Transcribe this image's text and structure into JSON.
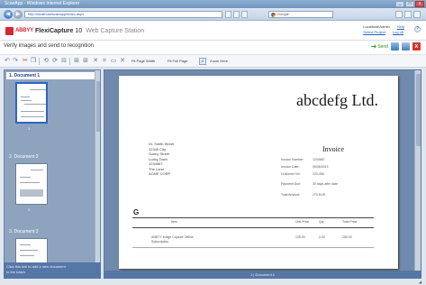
{
  "window": {
    "title": "ScanApp - Windows Internet Explorer",
    "buttons": {
      "minimize": "_",
      "maximize": "□",
      "close": "x"
    }
  },
  "browser": {
    "url": "http://localhost/scanapp/index.aspx",
    "search_placeholder": "Google",
    "back": "◀",
    "forward": "▶"
  },
  "app": {
    "brand": "ABBYY",
    "product": "FlexiCapture",
    "version": "10",
    "subtitle": "Web Capture Station",
    "header_links": {
      "line1": "Localhost\\Admin",
      "line2": "Select Project",
      "help": "Help",
      "logout": "Log off"
    },
    "help_icon": "?"
  },
  "instruction": {
    "text": "Verify images and send to recognition",
    "next_label": "Send",
    "close_glyph": "x"
  },
  "toolbar": {
    "icons": [
      "undo-icon",
      "redo-icon",
      "cut-icon",
      "copy-icon",
      "rotate-left-icon",
      "rotate-right-icon",
      "split-icon",
      "merge-icon",
      "delete-icon",
      "crop-icon",
      "deskew-icon",
      "zoom-icon"
    ],
    "glyphs": {
      "undo": "↶",
      "redo": "↷",
      "cut": "✂",
      "copy": "❐",
      "rotate_left": "⟲",
      "rotate_right": "⟳",
      "split": "⊟",
      "merge": "⊞",
      "delete": "✕",
      "crop": "⌗",
      "deskew": "▭",
      "zoom": "⌕"
    },
    "fit_width_label": "Fit Page Width",
    "fit_page_label": "Fit Full Page",
    "zoom_in_label": "Zoom Here"
  },
  "thumbnails": {
    "groups": [
      {
        "label": "1. Document 1",
        "page": "1"
      },
      {
        "label": "2. Document 2",
        "page": "2"
      },
      {
        "label": "3. Document 3",
        "page": "3"
      }
    ],
    "footer_line1": "Click this link to add a new document",
    "footer_line2": "to the batch"
  },
  "document": {
    "company": "abcdefg Ltd.",
    "address_lines": [
      "Dr. Smith Street",
      "12345 City",
      "Sunny Street",
      "Lucky Town",
      "1234567",
      "The Land",
      "ACME CORP"
    ],
    "invoice_title": "Invoice",
    "fields": [
      {
        "key": "Invoice Number:",
        "value": "1234567"
      },
      {
        "key": "Invoice Date:",
        "value": "05/06/2013"
      },
      {
        "key": "Customer No:",
        "value": "123-456"
      },
      {
        "key": "Payment Due:",
        "value": "30 days after date"
      },
      {
        "key": "Total Amount:",
        "value": "275 EUR"
      }
    ],
    "logo_mark": "G",
    "table": {
      "headers": [
        "Item",
        "Unit Price",
        "Qty",
        "Total Price"
      ],
      "row_item": "ABBYY Image Capture Offline",
      "row_item2": "Subscription",
      "row_values": [
        "125.00",
        "2.00",
        "250.00"
      ]
    }
  },
  "status_bar": {
    "text": "1 | Document 1"
  }
}
